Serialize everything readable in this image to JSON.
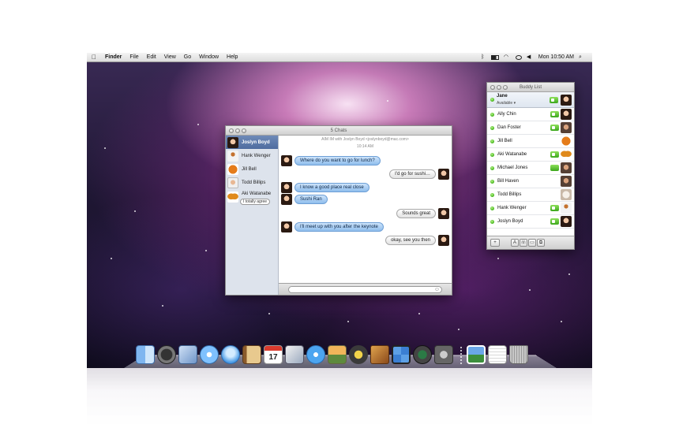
{
  "menubar": {
    "apple": "",
    "items": [
      "Finder",
      "File",
      "Edit",
      "View",
      "Go",
      "Window",
      "Help"
    ],
    "clock": "Mon 10:50 AM",
    "status_icons": [
      "bluetooth-icon",
      "wifi-icon",
      "ichat-status-icon",
      "volume-icon",
      "battery-icon",
      "spotlight-icon"
    ]
  },
  "chat_window": {
    "title": "5 Chats",
    "header": "AIM IM with Joslyn Boyd <joslynboyd@mac.com>",
    "time": "10:14 AM",
    "tabs": [
      {
        "name": "Joslyn Boyd",
        "avatar": "woman",
        "active": true
      },
      {
        "name": "Hank Wenger",
        "avatar": "gingerbread",
        "active": false
      },
      {
        "name": "Jill Bell",
        "avatar": "basketball",
        "active": false
      },
      {
        "name": "Todd Billips",
        "avatar": "man",
        "active": false
      },
      {
        "name": "Aki Watanabe",
        "avatar": "butterfly",
        "active": false,
        "sub": "I totally agree"
      }
    ],
    "messages": [
      {
        "side": "left",
        "text": "Where do you want to go for lunch?"
      },
      {
        "side": "right",
        "text": "I'd go for sushi…"
      },
      {
        "side": "left",
        "text": "I know a good place real close"
      },
      {
        "side": "left",
        "text": "Sushi Ran"
      },
      {
        "side": "right",
        "text": "Sounds great"
      },
      {
        "side": "left",
        "text": "I'll meet up with you after the keynote"
      },
      {
        "side": "right",
        "text": "okay, see you then"
      }
    ],
    "input_placeholder": ""
  },
  "buddy_list": {
    "title": "Buddy List",
    "me": {
      "name": "Jane",
      "status": "Available ▾"
    },
    "buddies": [
      {
        "name": "Ally Chin",
        "video": true,
        "avatar": "woman"
      },
      {
        "name": "Dan Foster",
        "video": true,
        "avatar": "man2"
      },
      {
        "name": "Jill Bell",
        "video": false,
        "avatar": "basketball"
      },
      {
        "name": "Aki Watanabe",
        "video": true,
        "avatar": "butterfly"
      },
      {
        "name": "Michael Jones",
        "video": false,
        "phone": true,
        "avatar": "man2"
      },
      {
        "name": "Bill Haven",
        "video": false,
        "avatar": "man2"
      },
      {
        "name": "Todd Billips",
        "video": false,
        "avatar": "puppy"
      },
      {
        "name": "Hank Wenger",
        "video": true,
        "avatar": "gingerbread"
      },
      {
        "name": "Joslyn Boyd",
        "video": true,
        "avatar": "woman"
      }
    ],
    "footer": {
      "add": "+",
      "aim": "A",
      "call": "☏",
      "video": "▭",
      "screen": "⧉"
    }
  },
  "dock": {
    "apps": [
      "Finder",
      "Dashboard",
      "Mail",
      "Safari",
      "iChat",
      "Address Book",
      "iCal",
      "Preview",
      "iTunes",
      "iPhoto",
      "iMovie",
      "GarageBand",
      "Spaces",
      "Time Machine",
      "System Preferences"
    ],
    "ical_day": "17",
    "stacks": [
      "Photo Booth",
      "Documents",
      "Trash"
    ]
  }
}
